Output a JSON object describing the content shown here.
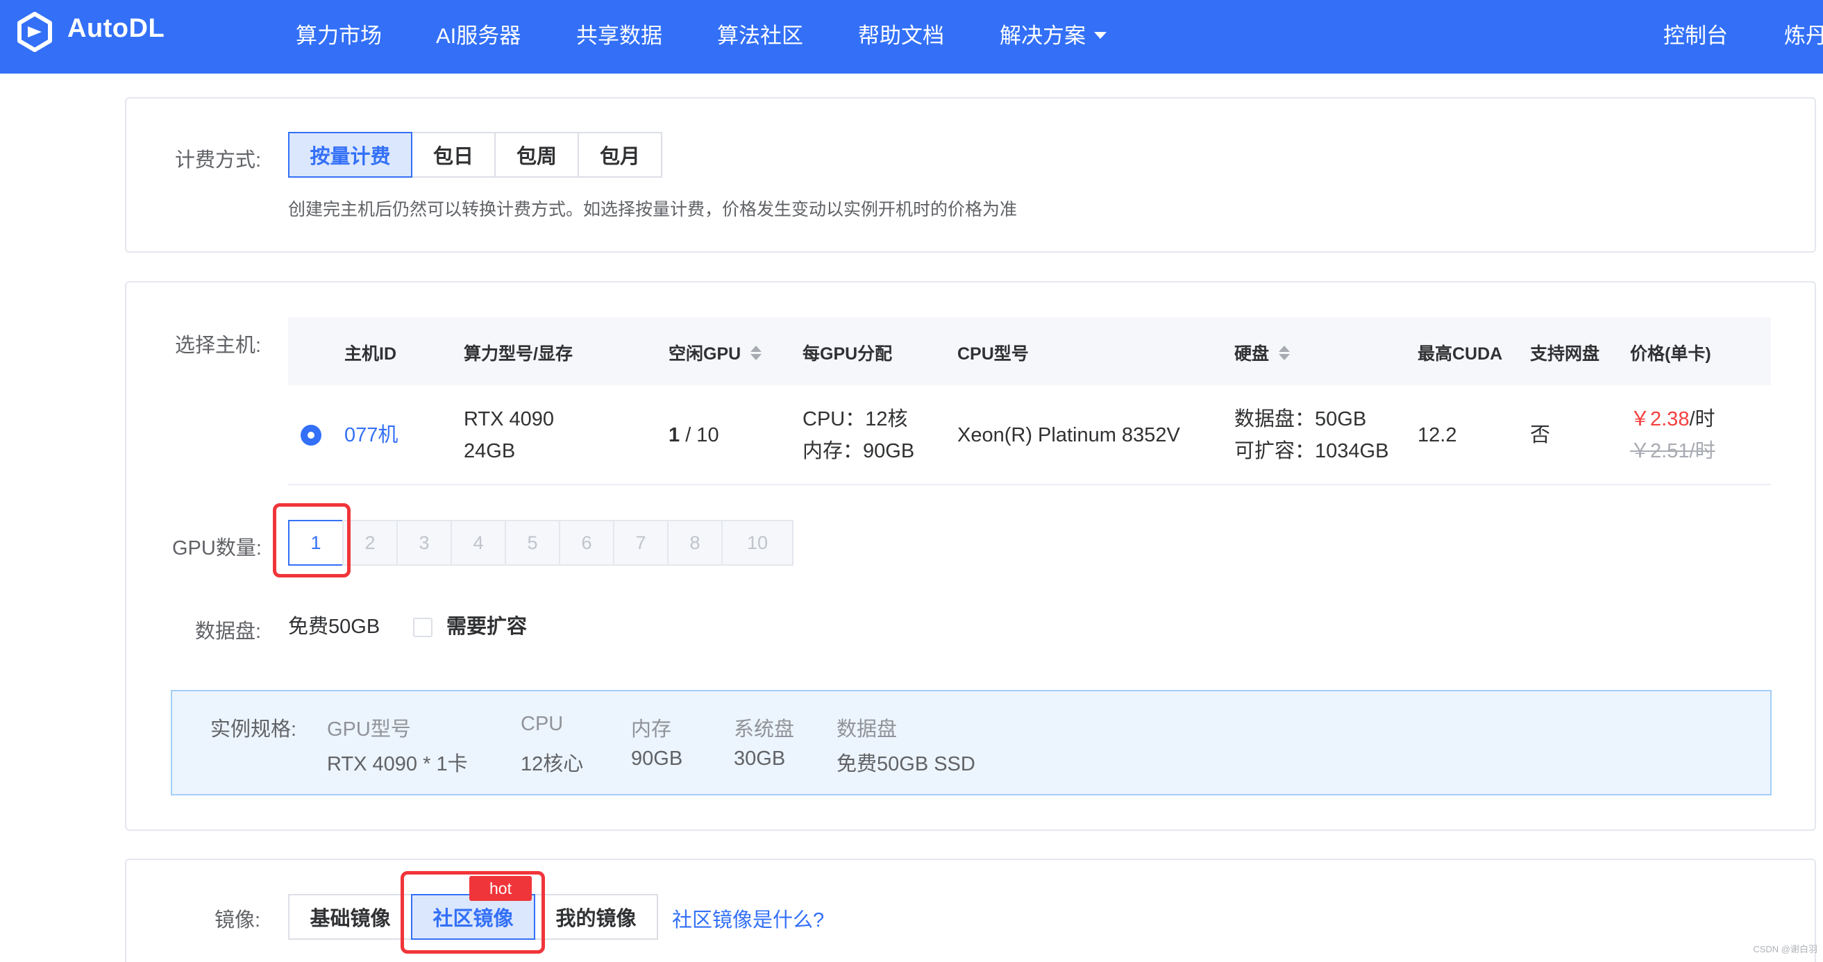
{
  "nav": {
    "brand": "AutoDL",
    "items": [
      "算力市场",
      "AI服务器",
      "共享数据",
      "算法社区",
      "帮助文档",
      "解决方案"
    ],
    "console": "控制台",
    "user": "炼丹"
  },
  "billing": {
    "label": "计费方式:",
    "options": [
      "按量计费",
      "包日",
      "包周",
      "包月"
    ],
    "hint": "创建完主机后仍然可以转换计费方式。如选择按量计费，价格发生变动以实例开机时的价格为准"
  },
  "host": {
    "label": "选择主机:",
    "columns": [
      "主机ID",
      "算力型号/显存",
      "空闲GPU",
      "每GPU分配",
      "CPU型号",
      "硬盘",
      "最高CUDA",
      "支持网盘",
      "价格(单卡)"
    ],
    "row": {
      "id": "077机",
      "model": "RTX 4090",
      "vram": "24GB",
      "free_gpu_a": "1",
      "free_gpu_b": " / 10",
      "cpu_alloc": "CPU：12核",
      "mem_alloc": "内存：90GB",
      "cpu_model": "Xeon(R) Platinum 8352V",
      "disk": "数据盘：50GB",
      "disk_expand": "可扩容：1034GB",
      "cuda": "12.2",
      "netdisk": "否",
      "price": "￥2.38",
      "price_unit": "/时",
      "old_price": "￥2.51/时"
    }
  },
  "gpu_count": {
    "label": "GPU数量:",
    "options": [
      "1",
      "2",
      "3",
      "4",
      "5",
      "6",
      "7",
      "8",
      "10"
    ],
    "selected": "1"
  },
  "data_disk": {
    "label": "数据盘:",
    "value": "免费50GB",
    "expand_label": "需要扩容"
  },
  "spec": {
    "label": "实例规格:",
    "headers": [
      "GPU型号",
      "CPU",
      "内存",
      "系统盘",
      "数据盘"
    ],
    "values": [
      "RTX 4090 * 1卡",
      "12核心",
      "90GB",
      "30GB",
      "免费50GB SSD"
    ]
  },
  "image": {
    "label": "镜像:",
    "tabs": [
      "基础镜像",
      "社区镜像",
      "我的镜像"
    ],
    "hot_badge": "hot",
    "help_link": "社区镜像是什么?"
  },
  "watermark": "CSDN @谢白羽",
  "colors": {
    "brand": "#3370f7",
    "highlight": "#f0353a",
    "price": "#f53f3f"
  }
}
